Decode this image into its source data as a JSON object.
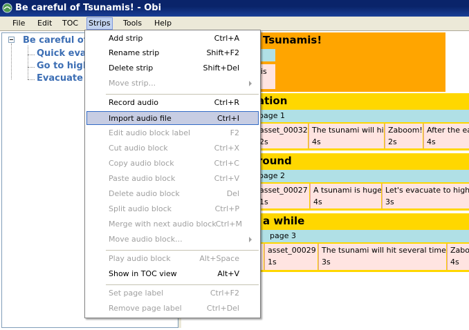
{
  "window": {
    "title": "Be careful of Tsunamis! - Obi"
  },
  "menubar": {
    "items": [
      "File",
      "Edit",
      "TOC",
      "Strips",
      "Tools",
      "Help"
    ]
  },
  "tree": {
    "root": "Be careful of",
    "children": [
      "Quick eva",
      "Go to high",
      "Evacuate"
    ]
  },
  "strips": [
    {
      "title": "Tsunamis!",
      "label_frag": "nis",
      "color": "#ffa500"
    },
    {
      "title": "ation",
      "page": "page 1",
      "blocks": [
        {
          "n": "asset_00032",
          "d": "2s"
        },
        {
          "n": "The tsunami will hit",
          "d": "4s"
        },
        {
          "n": "Zaboom!",
          "d": "2s"
        },
        {
          "n": "After the ea",
          "d": "4s"
        }
      ]
    },
    {
      "title": "round",
      "page": "page 2",
      "blocks": [
        {
          "n": "asset_00027",
          "d": "1s"
        },
        {
          "n": "A tsunami is huge",
          "d": "4s"
        },
        {
          "n": "Let's evacuate to high g",
          "d": "3s"
        }
      ]
    },
    {
      "title": "a while",
      "page": "page 3",
      "blocks": [
        {
          "n": "e",
          "d": ""
        },
        {
          "n": "asset_00029",
          "d": "1s"
        },
        {
          "n": "The tsunami will hit several times",
          "d": "3s"
        },
        {
          "n": "Zabo",
          "d": "4s"
        }
      ]
    }
  ],
  "strips_menu": {
    "items": [
      {
        "label": "Add strip",
        "shortcut": "Ctrl+A",
        "enabled": true
      },
      {
        "label": "Rename strip",
        "shortcut": "Shift+F2",
        "enabled": true
      },
      {
        "label": "Delete strip",
        "shortcut": "Shift+Del",
        "enabled": true
      },
      {
        "label": "Move strip...",
        "shortcut": "",
        "enabled": false,
        "submenu": true
      },
      {
        "label": "Record audio",
        "shortcut": "Ctrl+R",
        "enabled": true
      },
      {
        "label": "Import audio file",
        "shortcut": "Ctrl+I",
        "enabled": true,
        "highlighted": true
      },
      {
        "label": "Edit audio block label",
        "shortcut": "F2",
        "enabled": false
      },
      {
        "label": "Cut audio block",
        "shortcut": "Ctrl+X",
        "enabled": false
      },
      {
        "label": "Copy audio block",
        "shortcut": "Ctrl+C",
        "enabled": false
      },
      {
        "label": "Paste audio block",
        "shortcut": "Ctrl+V",
        "enabled": false
      },
      {
        "label": "Delete audio block",
        "shortcut": "Del",
        "enabled": false
      },
      {
        "label": "Split audio block",
        "shortcut": "Ctrl+P",
        "enabled": false
      },
      {
        "label": "Merge with next audio block",
        "shortcut": "Ctrl+M",
        "enabled": false
      },
      {
        "label": "Move audio block...",
        "shortcut": "",
        "enabled": false,
        "submenu": true
      },
      {
        "label": "Play audio block",
        "shortcut": "Alt+Space",
        "enabled": false
      },
      {
        "label": "Show in TOC view",
        "shortcut": "Alt+V",
        "enabled": true
      },
      {
        "label": "Set page label",
        "shortcut": "Ctrl+F2",
        "enabled": false
      },
      {
        "label": "Remove page label",
        "shortcut": "Ctrl+Del",
        "enabled": false
      }
    ]
  },
  "colors": {
    "strip_section": "#ffd700",
    "strip_book": "#ffa500",
    "page_bar": "#b0e0e6",
    "block": "#ffe4e1",
    "tree_text": "#3c6eb4"
  }
}
